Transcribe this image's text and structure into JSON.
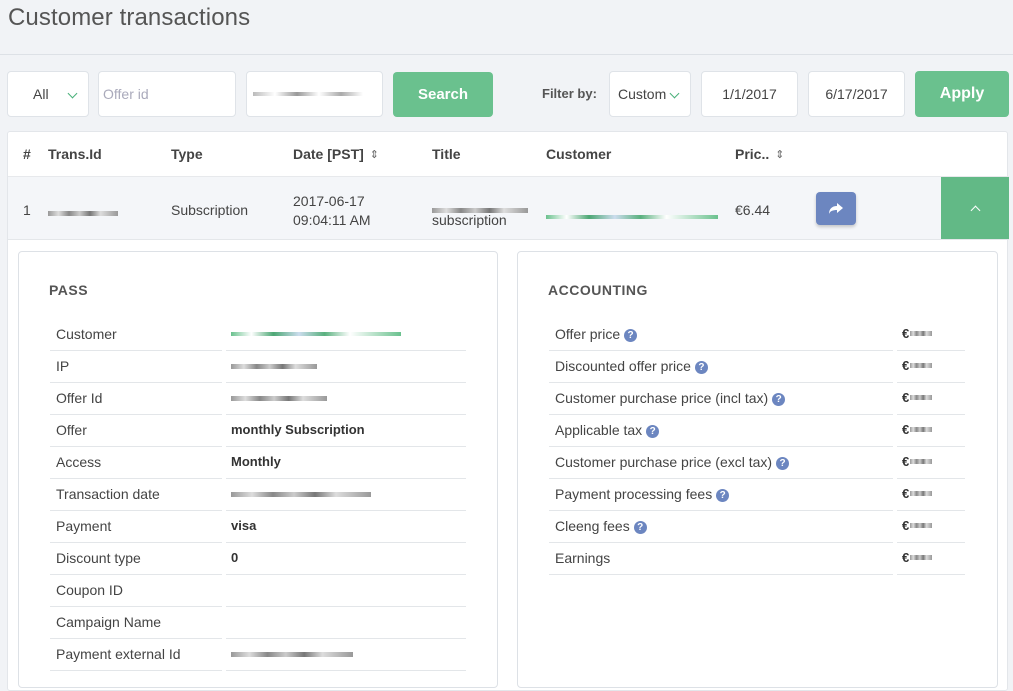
{
  "page": {
    "title": "Customer transactions"
  },
  "filters": {
    "type_select": {
      "value": "All"
    },
    "offer_input": {
      "placeholder": "Offer id",
      "value": ""
    },
    "search_button": "Search",
    "filter_label": "Filter by:",
    "period_select": {
      "value": "Custom"
    },
    "date_from": "1/1/2017",
    "date_to": "6/17/2017",
    "apply_button": "Apply"
  },
  "table": {
    "columns": {
      "index": "#",
      "trans_id": "Trans.Id",
      "type": "Type",
      "date": "Date [PST]",
      "title": "Title",
      "customer": "Customer",
      "price": "Pric.."
    },
    "rows": [
      {
        "index": "1",
        "type": "Subscription",
        "date_line1": "2017-06-17",
        "date_line2": "09:04:11 AM",
        "title_line2": "subscription",
        "price": "€6.44"
      }
    ]
  },
  "pass": {
    "title": "PASS",
    "rows": [
      {
        "label": "Customer",
        "value": ""
      },
      {
        "label": "IP",
        "value": ""
      },
      {
        "label": "Offer Id",
        "value": ""
      },
      {
        "label": "Offer",
        "value": "monthly Subscription"
      },
      {
        "label": "Access",
        "value": "Monthly"
      },
      {
        "label": "Transaction date",
        "value": ""
      },
      {
        "label": "Payment",
        "value": "visa"
      },
      {
        "label": "Discount type",
        "value": "0"
      },
      {
        "label": "Coupon ID",
        "value": ""
      },
      {
        "label": "Campaign Name",
        "value": ""
      },
      {
        "label": "Payment external Id",
        "value": ""
      }
    ]
  },
  "accounting": {
    "title": "ACCOUNTING",
    "rows": [
      {
        "label": "Offer price"
      },
      {
        "label": "Discounted offer price"
      },
      {
        "label": "Customer purchase price (incl tax)"
      },
      {
        "label": "Applicable tax"
      },
      {
        "label": "Customer purchase price (excl tax)"
      },
      {
        "label": "Payment processing fees"
      },
      {
        "label": "Cleeng fees"
      },
      {
        "label": "Earnings"
      }
    ],
    "currency_prefix": "€"
  },
  "colors": {
    "accent": "#6ac18e",
    "share_button": "#6c86c0"
  },
  "icons": {
    "share": "share-arrow-icon",
    "help": "help-circle-icon",
    "sort": "sort-icon",
    "collapse": "chevron-up-icon"
  }
}
